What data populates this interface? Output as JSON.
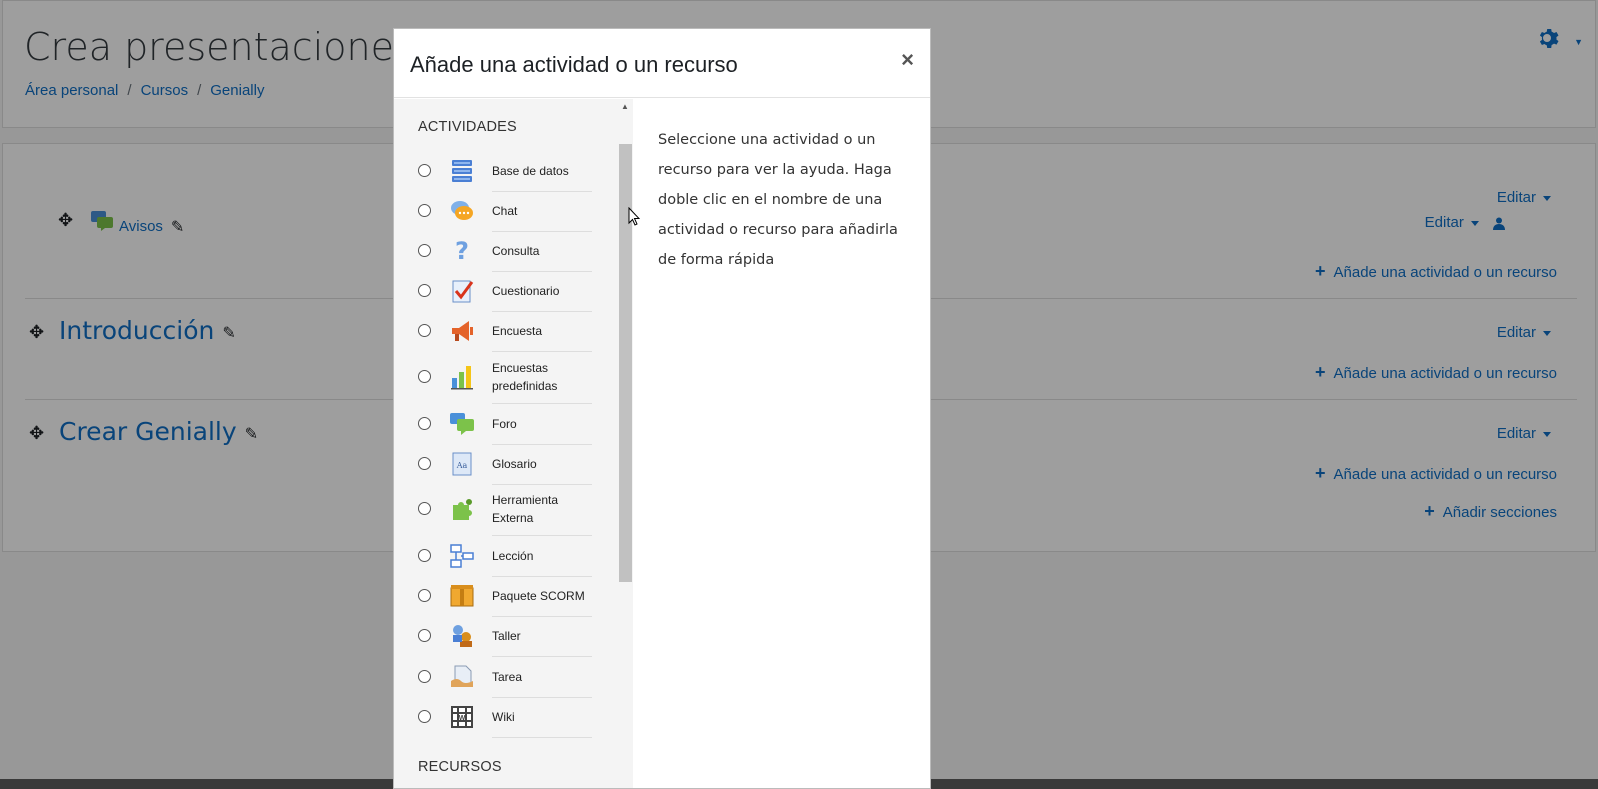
{
  "page": {
    "title": "Crea presentaciones ani",
    "breadcrumb": [
      "Área personal",
      "Cursos",
      "Genially"
    ],
    "sections": [
      {
        "edit_label": "Editar",
        "activity": "Avisos",
        "item_edit_label": "Editar",
        "add_label": "Añade una actividad o un recurso"
      },
      {
        "title": "Introducción",
        "edit_label": "Editar",
        "add_label": "Añade una actividad o un recurso"
      },
      {
        "title": "Crear Genially",
        "edit_label": "Editar",
        "add_label": "Añade una actividad o un recurso"
      }
    ],
    "add_sections_label": "Añadir secciones"
  },
  "modal": {
    "title": "Añade una actividad o un recurso",
    "close": "×",
    "activities_heading": "ACTIVIDADES",
    "resources_heading": "RECURSOS",
    "help_text": "Seleccione una actividad o un recurso para ver la ayuda. Haga doble clic en el nombre de una actividad o recurso para añadirla de forma rápida",
    "activities": [
      {
        "label": "Base de datos",
        "icon": "database-icon"
      },
      {
        "label": "Chat",
        "icon": "chat-icon"
      },
      {
        "label": "Consulta",
        "icon": "question-icon"
      },
      {
        "label": "Cuestionario",
        "icon": "quiz-icon"
      },
      {
        "label": "Encuesta",
        "icon": "megaphone-icon"
      },
      {
        "label": "Encuestas predefinidas",
        "icon": "bar-chart-icon"
      },
      {
        "label": "Foro",
        "icon": "forum-icon"
      },
      {
        "label": "Glosario",
        "icon": "glossary-icon"
      },
      {
        "label": "Herramienta Externa",
        "icon": "puzzle-icon"
      },
      {
        "label": "Lección",
        "icon": "lesson-icon"
      },
      {
        "label": "Paquete SCORM",
        "icon": "package-icon"
      },
      {
        "label": "Taller",
        "icon": "workshop-icon"
      },
      {
        "label": "Tarea",
        "icon": "assignment-icon"
      },
      {
        "label": "Wiki",
        "icon": "wiki-icon"
      }
    ]
  },
  "colors": {
    "link": "#0f6fc5",
    "overlay": "rgba(0,0,0,0.38)"
  }
}
